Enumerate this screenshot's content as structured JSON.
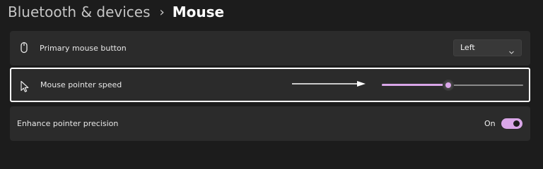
{
  "breadcrumb": {
    "parent": "Bluetooth & devices",
    "separator": "›",
    "current": "Mouse"
  },
  "settings": {
    "primary_button": {
      "label": "Primary mouse button",
      "icon": "mouse-icon",
      "selected_value": "Left"
    },
    "pointer_speed": {
      "label": "Mouse pointer speed",
      "icon": "pointer-icon",
      "slider_level": 0.47
    },
    "pointer_precision": {
      "label": "Enhance pointer precision",
      "toggle_state_label": "On",
      "toggle_on": true
    }
  },
  "colors": {
    "background": "#1c1c1c",
    "card": "#2b2b2b",
    "accent": "#d9a6e8"
  }
}
